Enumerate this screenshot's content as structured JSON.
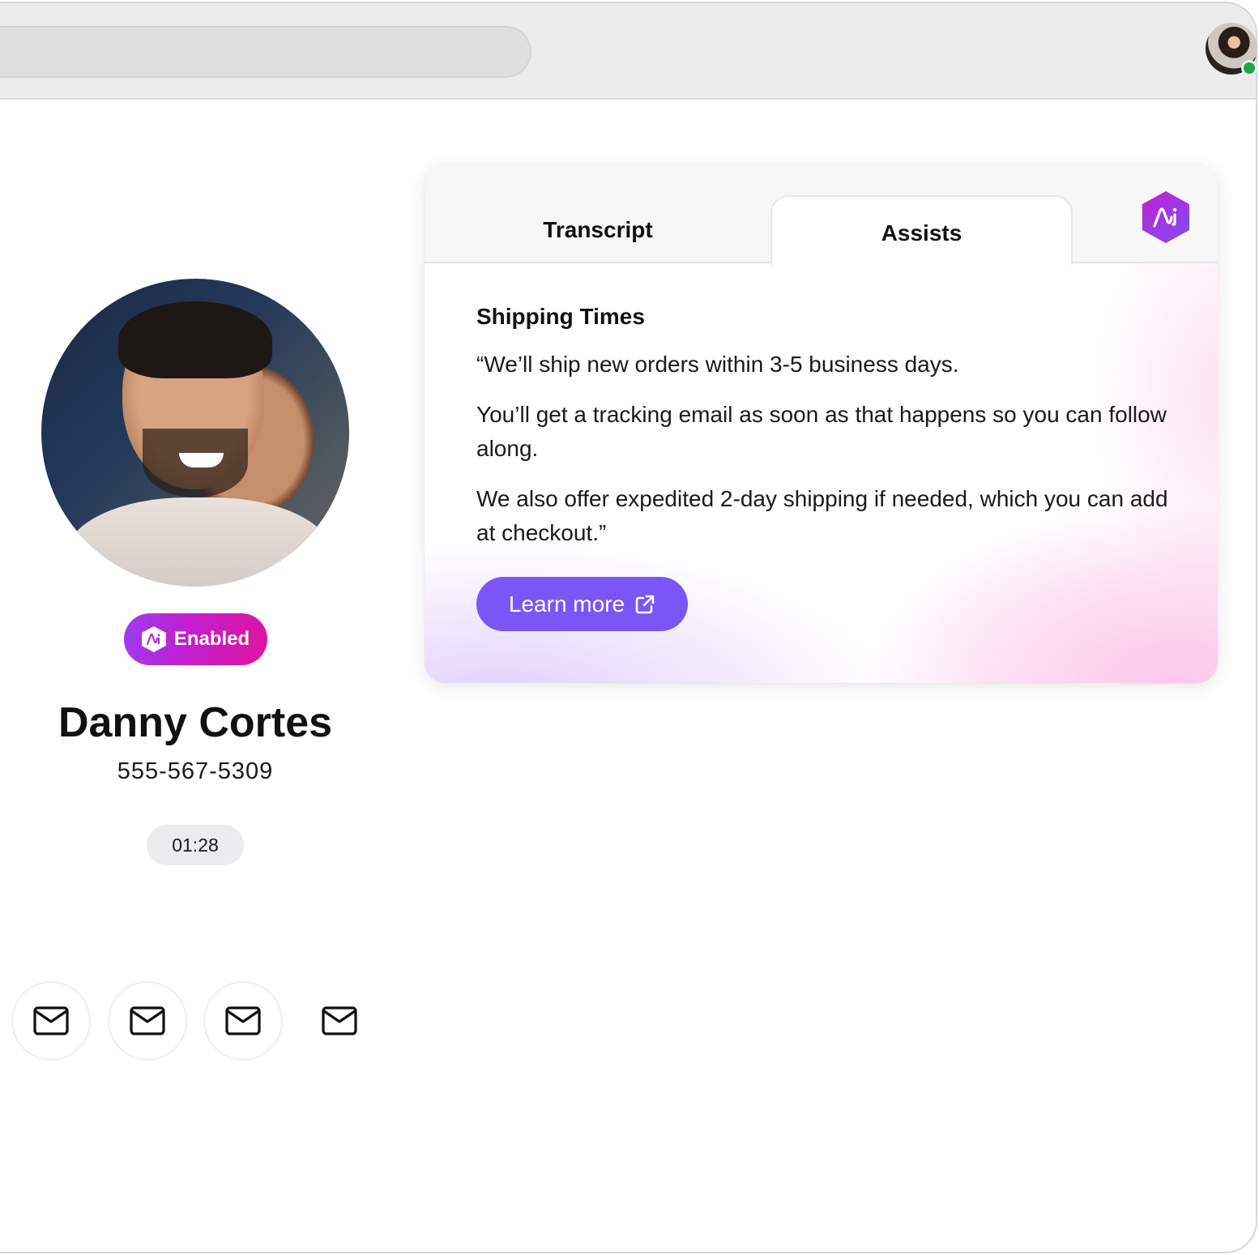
{
  "browser": {
    "url_bar_value": "",
    "user_avatar": "user-avatar-woman",
    "presence_status": "online",
    "presence_color": "#22a447"
  },
  "contact": {
    "photo": "contact-photo-man-smiling",
    "badge_label": "Enabled",
    "name": "Danny Cortes",
    "phone": "555-567-5309",
    "call_timer": "01:28",
    "actions": [
      {
        "icon": "mail-icon"
      },
      {
        "icon": "mail-icon"
      },
      {
        "icon": "mail-icon"
      },
      {
        "icon": "mail-icon"
      }
    ]
  },
  "assist_card": {
    "tabs": [
      {
        "label": "Transcript",
        "active": false
      },
      {
        "label": "Assists",
        "active": true
      }
    ],
    "brand_icon": "ai-hex-logo-icon",
    "title": "Shipping Times",
    "paragraphs": [
      "“We’ll ship new orders within 3-5 business days.",
      "You’ll get a tracking email as soon as that happens so you can follow along.",
      "We also offer expedited 2-day shipping if needed, which you can add at checkout.”"
    ],
    "cta_label": "Learn more",
    "cta_icon": "external-link-icon"
  },
  "colors": {
    "primary_button": "#7c55f7",
    "badge_gradient_start": "#9a3ef0",
    "badge_gradient_end": "#e0149e",
    "brand_hex_start": "#c31fd0",
    "brand_hex_end": "#7f4cf5"
  }
}
